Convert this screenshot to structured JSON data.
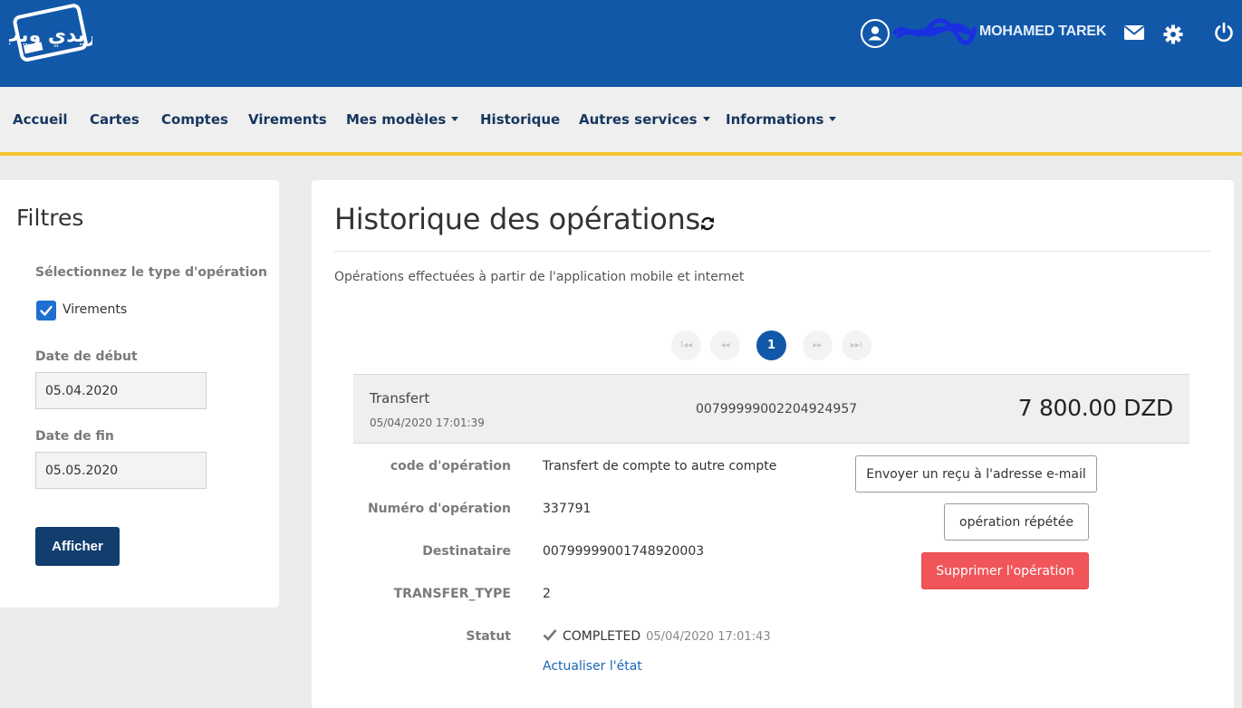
{
  "header": {
    "logo_text": "بريدي ويب",
    "username": "MOHAMED TAREK",
    "icons": [
      "user-icon",
      "mail-icon",
      "gear-icon",
      "power-icon"
    ]
  },
  "nav": {
    "items": [
      {
        "label": "Accueil"
      },
      {
        "label": "Cartes"
      },
      {
        "label": "Comptes"
      },
      {
        "label": "Virements"
      },
      {
        "label": "Mes modèles",
        "dropdown": true
      },
      {
        "label": "Historique"
      },
      {
        "label": "Autres services",
        "dropdown": true
      },
      {
        "label": "Informations",
        "dropdown": true
      }
    ]
  },
  "filters": {
    "title": "Filtres",
    "type_label": "Sélectionnez le type d'opération",
    "checkbox_label": "Virements",
    "checkbox_checked": true,
    "start_label": "Date de début",
    "start_value": "05.04.2020",
    "end_label": "Date de fin",
    "end_value": "05.05.2020",
    "submit_label": "Afficher"
  },
  "main": {
    "title": "Historique des opérations",
    "subtitle": "Opérations effectuées à partir de l'application mobile et internet",
    "pagination": {
      "first": "I◂◂",
      "prev": "◂◂",
      "current": "1",
      "next": "▸▸",
      "last": "▸▸I"
    },
    "operation": {
      "type": "Transfert",
      "datetime": "05/04/2020 17:01:39",
      "account": "0079999900220492495 7",
      "account_display": "00799999002204924957",
      "amount": "7 800.00 DZD",
      "details": {
        "code_label": "code d'opération",
        "code_value": "Transfert de compte to autre compte",
        "number_label": "Numéro d'opération",
        "number_value": "337791",
        "dest_label": "Destinataire",
        "dest_value": "00799999001748920003",
        "transfer_type_label": "TRANSFER_TYPE",
        "transfer_type_value": "2",
        "status_label": "Statut",
        "status_value": "COMPLETED",
        "status_date": "05/04/2020 17:01:43",
        "refresh_link": "Actualiser l'état"
      },
      "actions": {
        "receipt": "Envoyer un reçu à l'adresse e-mail",
        "repeat": "opération répétée",
        "delete": "Supprimer l'opération"
      }
    }
  },
  "colors": {
    "header_bg": "#1258a9",
    "nav_accent": "#f5c32c",
    "primary_button": "#123e6e",
    "danger_button": "#f0555a"
  }
}
